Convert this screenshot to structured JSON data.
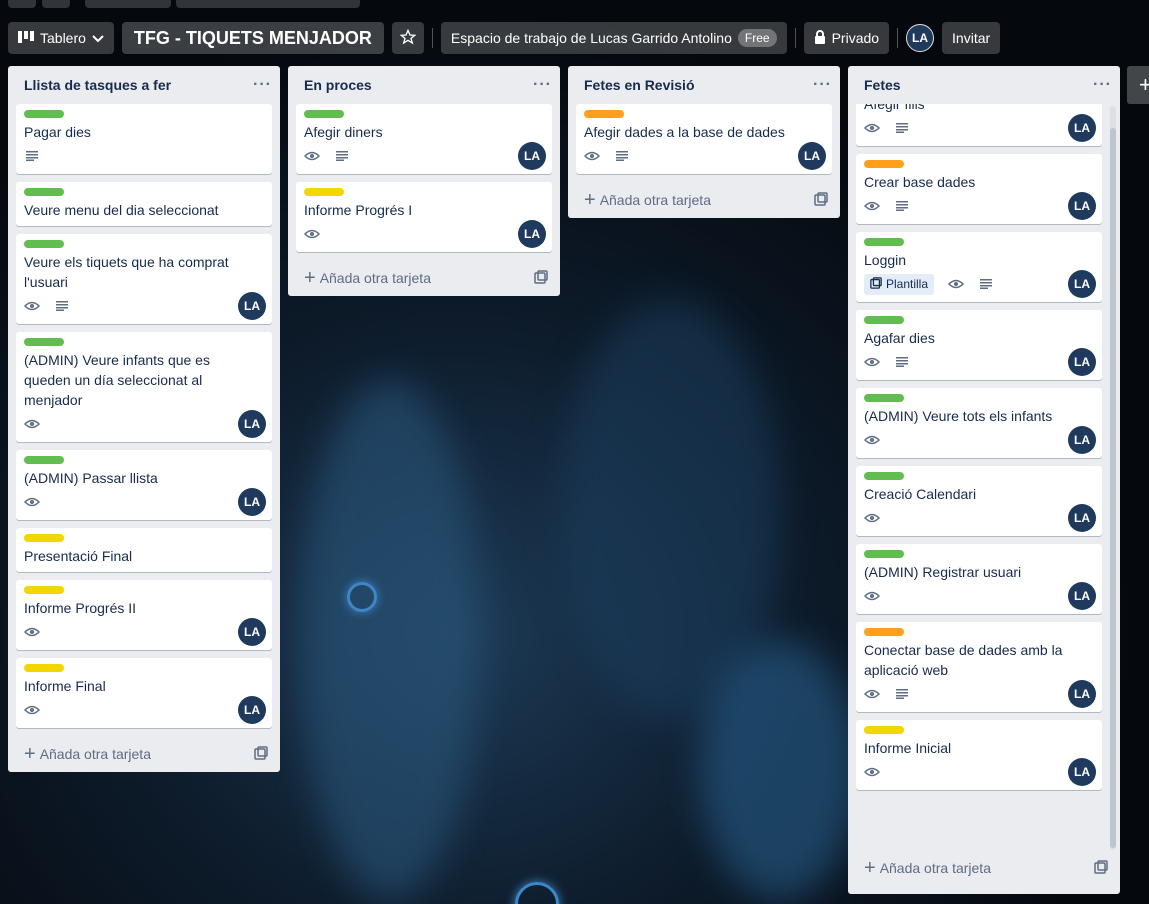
{
  "header": {
    "view_label": "Tablero",
    "board_title": "TFG - TIQUETS MENJADOR",
    "workspace": "Espacio de trabajo de Lucas Garrido Antolino",
    "workspace_badge": "Free",
    "visibility": "Privado",
    "member_initials": "LA",
    "invite_label": "Invitar"
  },
  "colors": {
    "green": "#61bd4f",
    "yellow": "#f2d600",
    "orange": "#ff9f1a",
    "avatar": "#1f3a5c"
  },
  "add_card_label": "Añada otra tarjeta",
  "lists": [
    {
      "title": "Llista de tasques a fer",
      "cards": [
        {
          "label": "green",
          "title": "Pagar dies",
          "watch": false,
          "desc": true,
          "avatar": ""
        },
        {
          "label": "green",
          "title": "Veure menu del dia seleccionat",
          "watch": false,
          "desc": false,
          "avatar": ""
        },
        {
          "label": "green",
          "title": "Veure els tiquets que ha comprat l'usuari",
          "watch": true,
          "desc": true,
          "avatar": "LA"
        },
        {
          "label": "green",
          "title": "(ADMIN) Veure infants que es queden un día seleccionat al menjador",
          "watch": true,
          "desc": false,
          "avatar": "LA"
        },
        {
          "label": "green",
          "title": "(ADMIN) Passar llista",
          "watch": true,
          "desc": false,
          "avatar": "LA"
        },
        {
          "label": "yellow",
          "title": "Presentació Final",
          "watch": false,
          "desc": false,
          "avatar": ""
        },
        {
          "label": "yellow",
          "title": "Informe Progrés II",
          "watch": true,
          "desc": false,
          "avatar": "LA"
        },
        {
          "label": "yellow",
          "title": "Informe Final",
          "watch": true,
          "desc": false,
          "avatar": "LA"
        }
      ]
    },
    {
      "title": "En proces",
      "cards": [
        {
          "label": "green",
          "title": "Afegir diners",
          "watch": true,
          "desc": true,
          "avatar": "LA"
        },
        {
          "label": "yellow",
          "title": "Informe Progrés I",
          "watch": true,
          "desc": false,
          "avatar": "LA"
        }
      ]
    },
    {
      "title": "Fetes en Revisió",
      "cards": [
        {
          "label": "orange",
          "title": "Afegir dades a la base de dades",
          "watch": true,
          "desc": true,
          "avatar": "LA"
        }
      ]
    },
    {
      "title": "Fetes",
      "cards": [
        {
          "label": "",
          "title": "Afegir fills",
          "watch": true,
          "desc": true,
          "avatar": "LA"
        },
        {
          "label": "orange",
          "title": "Crear base dades",
          "watch": true,
          "desc": true,
          "avatar": "LA"
        },
        {
          "label": "green",
          "title": "Loggin",
          "template": "Plantilla",
          "watch": true,
          "desc": true,
          "avatar": "LA"
        },
        {
          "label": "green",
          "title": "Agafar dies",
          "watch": true,
          "desc": true,
          "avatar": "LA"
        },
        {
          "label": "green",
          "title": "(ADMIN) Veure tots els infants",
          "watch": true,
          "desc": false,
          "avatar": "LA"
        },
        {
          "label": "green",
          "title": "Creació Calendari",
          "watch": true,
          "desc": false,
          "avatar": "LA"
        },
        {
          "label": "green",
          "title": "(ADMIN) Registrar usuari",
          "watch": true,
          "desc": false,
          "avatar": "LA"
        },
        {
          "label": "orange",
          "title": "Conectar base de dades amb la aplicació web",
          "watch": true,
          "desc": true,
          "avatar": "LA"
        },
        {
          "label": "yellow",
          "title": "Informe Inicial",
          "watch": true,
          "desc": false,
          "avatar": "LA"
        }
      ]
    }
  ]
}
